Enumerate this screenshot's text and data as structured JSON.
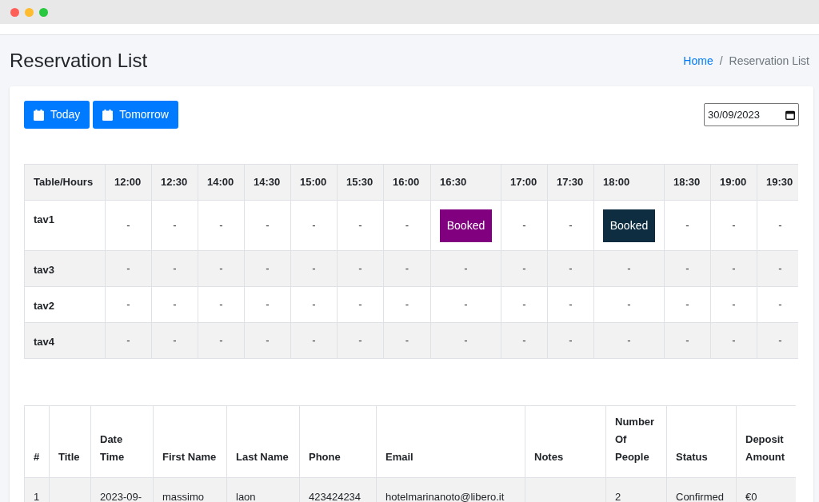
{
  "page": {
    "title": "Reservation List"
  },
  "breadcrumb": [
    {
      "label": "Home",
      "kind": "link"
    },
    {
      "label": "/",
      "kind": "separator"
    },
    {
      "label": "Reservation List",
      "kind": "current"
    }
  ],
  "buttons": [
    {
      "label": "Today"
    },
    {
      "label": "Tomorrow"
    }
  ],
  "date_field": {
    "value": "30/09/2023"
  },
  "schedule": {
    "corner": "Table/Hours",
    "columns": [
      "12:00",
      "12:30",
      "14:00",
      "14:30",
      "15:00",
      "15:30",
      "16:00",
      "16:30",
      "17:00",
      "17:30",
      "18:00",
      "18:30",
      "19:00",
      "19:30"
    ],
    "rows": [
      {
        "table": "tav1",
        "slots": [
          {
            "kind": "empty",
            "text": "-"
          },
          {
            "kind": "empty",
            "text": "-"
          },
          {
            "kind": "empty",
            "text": "-"
          },
          {
            "kind": "empty",
            "text": "-"
          },
          {
            "kind": "empty",
            "text": "-"
          },
          {
            "kind": "empty",
            "text": "-"
          },
          {
            "kind": "empty",
            "text": "-"
          },
          {
            "kind": "booked",
            "text": "Booked",
            "color": "#800080"
          },
          {
            "kind": "empty",
            "text": "-"
          },
          {
            "kind": "empty",
            "text": "-"
          },
          {
            "kind": "booked",
            "text": "Booked",
            "color": "#0f2d40"
          },
          {
            "kind": "empty",
            "text": "-"
          },
          {
            "kind": "empty",
            "text": "-"
          },
          {
            "kind": "empty",
            "text": "-"
          }
        ]
      },
      {
        "table": "tav3",
        "slots": [
          {
            "kind": "empty",
            "text": "-"
          },
          {
            "kind": "empty",
            "text": "-"
          },
          {
            "kind": "empty",
            "text": "-"
          },
          {
            "kind": "empty",
            "text": "-"
          },
          {
            "kind": "empty",
            "text": "-"
          },
          {
            "kind": "empty",
            "text": "-"
          },
          {
            "kind": "empty",
            "text": "-"
          },
          {
            "kind": "empty",
            "text": "-"
          },
          {
            "kind": "empty",
            "text": "-"
          },
          {
            "kind": "empty",
            "text": "-"
          },
          {
            "kind": "empty",
            "text": "-"
          },
          {
            "kind": "empty",
            "text": "-"
          },
          {
            "kind": "empty",
            "text": "-"
          },
          {
            "kind": "empty",
            "text": "-"
          }
        ]
      },
      {
        "table": "tav2",
        "slots": [
          {
            "kind": "empty",
            "text": "-"
          },
          {
            "kind": "empty",
            "text": "-"
          },
          {
            "kind": "empty",
            "text": "-"
          },
          {
            "kind": "empty",
            "text": "-"
          },
          {
            "kind": "empty",
            "text": "-"
          },
          {
            "kind": "empty",
            "text": "-"
          },
          {
            "kind": "empty",
            "text": "-"
          },
          {
            "kind": "empty",
            "text": "-"
          },
          {
            "kind": "empty",
            "text": "-"
          },
          {
            "kind": "empty",
            "text": "-"
          },
          {
            "kind": "empty",
            "text": "-"
          },
          {
            "kind": "empty",
            "text": "-"
          },
          {
            "kind": "empty",
            "text": "-"
          },
          {
            "kind": "empty",
            "text": "-"
          }
        ]
      },
      {
        "table": "tav4",
        "slots": [
          {
            "kind": "empty",
            "text": "-"
          },
          {
            "kind": "empty",
            "text": "-"
          },
          {
            "kind": "empty",
            "text": "-"
          },
          {
            "kind": "empty",
            "text": "-"
          },
          {
            "kind": "empty",
            "text": "-"
          },
          {
            "kind": "empty",
            "text": "-"
          },
          {
            "kind": "empty",
            "text": "-"
          },
          {
            "kind": "empty",
            "text": "-"
          },
          {
            "kind": "empty",
            "text": "-"
          },
          {
            "kind": "empty",
            "text": "-"
          },
          {
            "kind": "empty",
            "text": "-"
          },
          {
            "kind": "empty",
            "text": "-"
          },
          {
            "kind": "empty",
            "text": "-"
          },
          {
            "kind": "empty",
            "text": "-"
          }
        ]
      }
    ]
  },
  "reservations": {
    "columns": [
      "#",
      "Title",
      "Date Time",
      "First Name",
      "Last Name",
      "Phone",
      "Email",
      "Notes",
      "Number Of People",
      "Status",
      "Deposit Amount"
    ],
    "rows": [
      {
        "cells": [
          "1",
          null,
          "2023-09-",
          "massimo",
          "laon",
          "423424234",
          "hotelmarinanoto@libero.it",
          null,
          "2",
          "Confirmed",
          "€0"
        ]
      }
    ]
  }
}
